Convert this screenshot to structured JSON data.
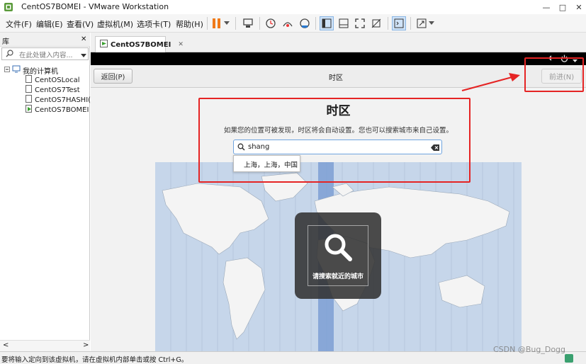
{
  "window": {
    "title": "CentOS7BOMEI - VMware Workstation",
    "controls": [
      "—",
      "□",
      "✕"
    ]
  },
  "menubar": {
    "items": [
      "文件(F)",
      "编辑(E)",
      "查看(V)",
      "虚拟机(M)",
      "选项卡(T)",
      "帮助(H)"
    ]
  },
  "library": {
    "title": "库",
    "close": "✕",
    "search_placeholder": "在此处键入内容...",
    "root": "我的计算机",
    "vms": [
      "CentOSLocal",
      "CentOS7Test",
      "CentOS7HASHI(",
      "CentOS7BOMEI"
    ],
    "scroll_left": "<",
    "scroll_right": ">"
  },
  "tab": {
    "label": "CentOS7BOMEI",
    "close": "✕"
  },
  "installer": {
    "back_button": "返回(P)",
    "header_title": "时区",
    "next_button": "前进(N)",
    "page_title": "时区",
    "description": "如果您的位置可被发现，时区将会自动设置。您也可以搜索城市来自己设置。",
    "search_value": "shang",
    "suggestion": "上海，上海，中国",
    "map_hint": "请搜索就近的城市"
  },
  "statusbar": {
    "message": "要将输入定向到该虚拟机，请在虚拟机内部单击或按 Ctrl+G。"
  },
  "watermark": "CSDN @Bug_Dogg",
  "colors": {
    "highlight_red": "#e52424",
    "map_ocean": "#c6d6ea",
    "map_land": "#f4f4f4",
    "timezone_band": "#7d9fd3"
  }
}
